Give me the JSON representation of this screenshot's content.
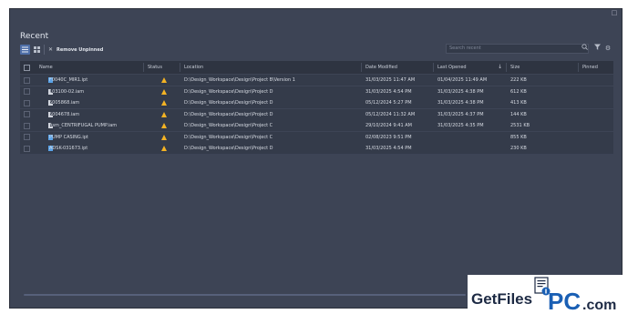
{
  "title": "Recent",
  "toolbar": {
    "remove_unpinned_label": "Remove Unpinned",
    "search_placeholder": "Search recent"
  },
  "columns": {
    "name": "Name",
    "status": "Status",
    "location": "Location",
    "date_modified": "Date Modified",
    "last_opened": "Last Opened",
    "size": "Size",
    "pinned": "Pinned"
  },
  "rows": [
    {
      "name": "F0040C_MIR1.ipt",
      "type": "ipt",
      "location": "D:\\Design_Workspace\\Design\\Project B\\Version 1",
      "date_modified": "31/03/2025 11:47 AM",
      "last_opened": "01/04/2025 11:49 AM",
      "size": "222 KB"
    },
    {
      "name": "103100-02.iam",
      "type": "iam",
      "location": "D:\\Design_Workspace\\Design\\Project D",
      "date_modified": "31/03/2025 4:54 PM",
      "last_opened": "31/03/2025 4:38 PM",
      "size": "612 KB"
    },
    {
      "name": "5005868.iam",
      "type": "iam",
      "location": "D:\\Design_Workspace\\Design\\Project D",
      "date_modified": "05/12/2024 5:27 PM",
      "last_opened": "31/03/2025 4:38 PM",
      "size": "413 KB"
    },
    {
      "name": "5004678.iam",
      "type": "iam",
      "location": "D:\\Design_Workspace\\Design\\Project D",
      "date_modified": "05/12/2024 11:32 AM",
      "last_opened": "31/03/2025 4:37 PM",
      "size": "144 KB"
    },
    {
      "name": "Asm_CENTRIFUGAL PUMP.iam",
      "type": "iam",
      "location": "D:\\Design_Workspace\\Design\\Project C",
      "date_modified": "29/10/2024 9:41 AM",
      "last_opened": "31/03/2025 4:35 PM",
      "size": "2531 KB"
    },
    {
      "name": "PUMP CASING.ipt",
      "type": "ipt",
      "location": "D:\\Design_Workspace\\Design\\Project C",
      "date_modified": "02/08/2023 9:51 PM",
      "last_opened": "",
      "size": "855 KB"
    },
    {
      "name": "ADSK-031673.ipt",
      "type": "ipt",
      "location": "D:\\Design_Workspace\\Design\\Project D",
      "date_modified": "31/03/2025 4:54 PM",
      "last_opened": "",
      "size": "230 KB"
    }
  ],
  "watermark": {
    "text_get": "GetFiles",
    "text_pc": "PC",
    "text_com": ".com"
  },
  "colors": {
    "accent": "#4f6fa8",
    "warning": "#f4b324",
    "ipt_icon": "#5aa3e8",
    "iam_icon": "#d0d4dc",
    "logo_blue": "#1a5fb4"
  }
}
